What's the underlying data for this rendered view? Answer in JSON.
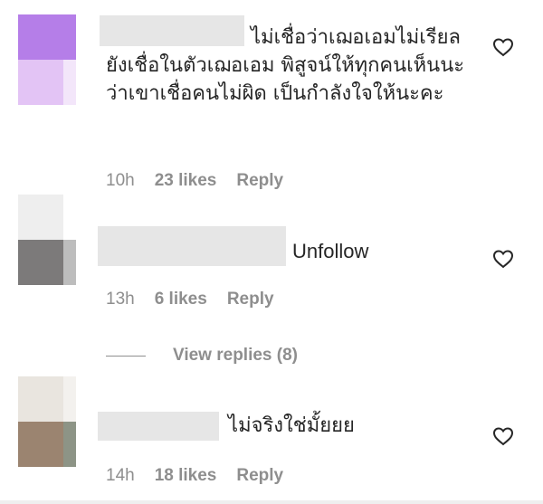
{
  "comments": [
    {
      "text": "ไม่เชื่อว่าเฌอเอมไม่เรียล ยังเชื่อในตัวเฌอเอม พิสูจน์ให้ทุกคนเห็นนะว่าเขาเชื่อคนไม่ผิด เป็นกำลังใจให้นะคะ",
      "time": "10h",
      "likes": "23 likes",
      "reply_label": "Reply"
    },
    {
      "text": "Unfollow",
      "time": "13h",
      "likes": "6 likes",
      "reply_label": "Reply"
    },
    {
      "text": "ไม่จริงใช่มั้ยยย",
      "time": "14h",
      "likes": "18 likes",
      "reply_label": "Reply"
    }
  ],
  "view_replies": "View replies (8)",
  "icons": {
    "like": "heart-outline-icon"
  },
  "colors": {
    "text": "#262626",
    "meta": "#8e8e8e"
  }
}
